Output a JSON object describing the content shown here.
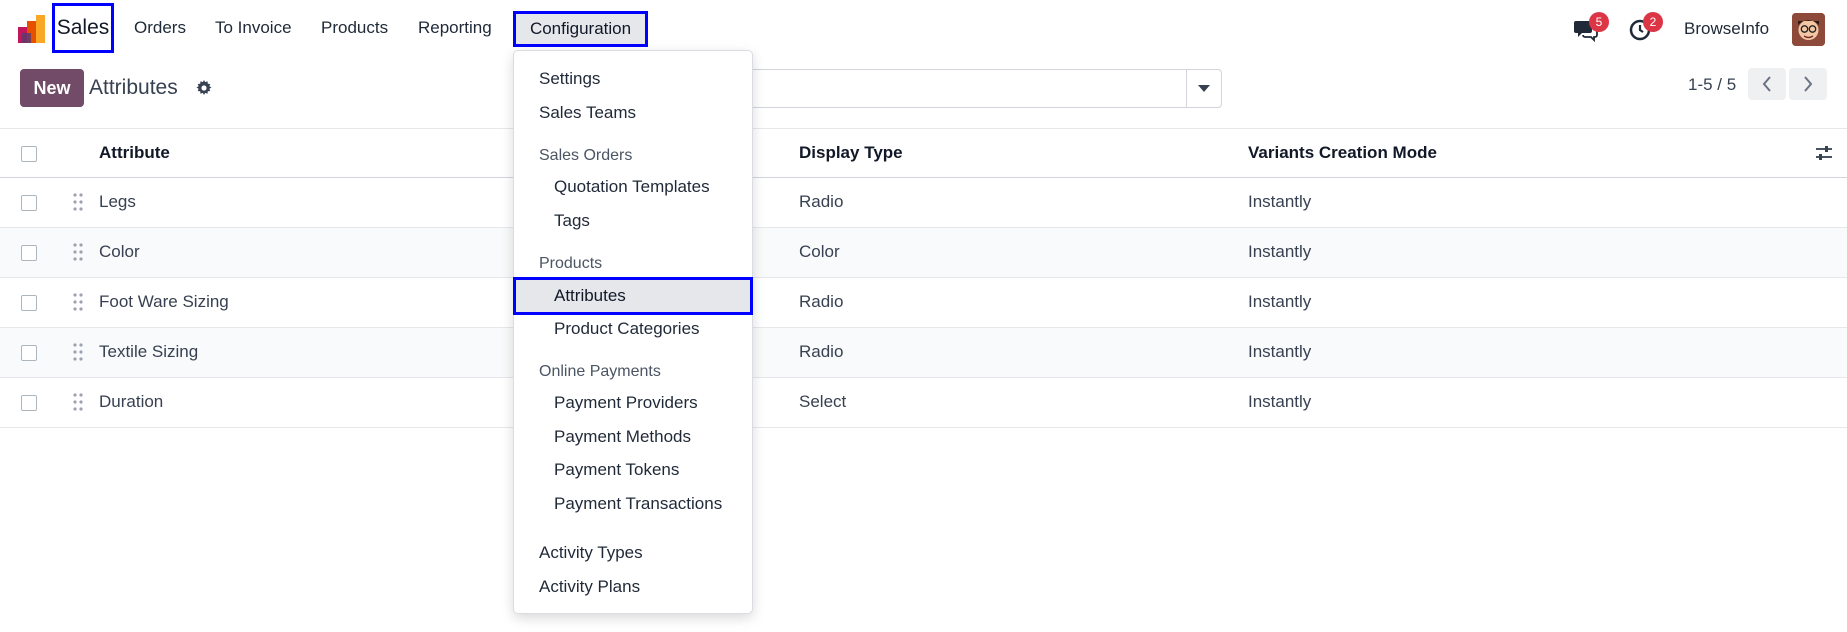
{
  "navbar": {
    "brand": "Sales",
    "menu": [
      "Orders",
      "To Invoice",
      "Products",
      "Reporting"
    ],
    "config": "Configuration",
    "messages_badge": "5",
    "activities_badge": "2",
    "user": "BrowseInfo"
  },
  "control": {
    "new_label": "New",
    "title": "Attributes",
    "pager": "1-5 / 5"
  },
  "table": {
    "columns": [
      "Attribute",
      "Display Type",
      "Variants Creation Mode"
    ],
    "rows": [
      {
        "name": "Legs",
        "display": "Radio",
        "mode": "Instantly"
      },
      {
        "name": "Color",
        "display": "Color",
        "mode": "Instantly"
      },
      {
        "name": "Foot Ware Sizing",
        "display": "Radio",
        "mode": "Instantly"
      },
      {
        "name": "Textile Sizing",
        "display": "Radio",
        "mode": "Instantly"
      },
      {
        "name": "Duration",
        "display": "Select",
        "mode": "Instantly"
      }
    ]
  },
  "dropdown": {
    "settings": "Settings",
    "sales_teams": "Sales Teams",
    "sales_orders_header": "Sales Orders",
    "quotation_templates": "Quotation Templates",
    "tags": "Tags",
    "products_header": "Products",
    "attributes": "Attributes",
    "product_categories": "Product Categories",
    "online_payments_header": "Online Payments",
    "payment_providers": "Payment Providers",
    "payment_methods": "Payment Methods",
    "payment_tokens": "Payment Tokens",
    "payment_transactions": "Payment Transactions",
    "activity_types": "Activity Types",
    "activity_plans": "Activity Plans"
  },
  "colors": {
    "primary": "#714b67",
    "highlight": "#0000ff",
    "badge": "#dc3545"
  }
}
